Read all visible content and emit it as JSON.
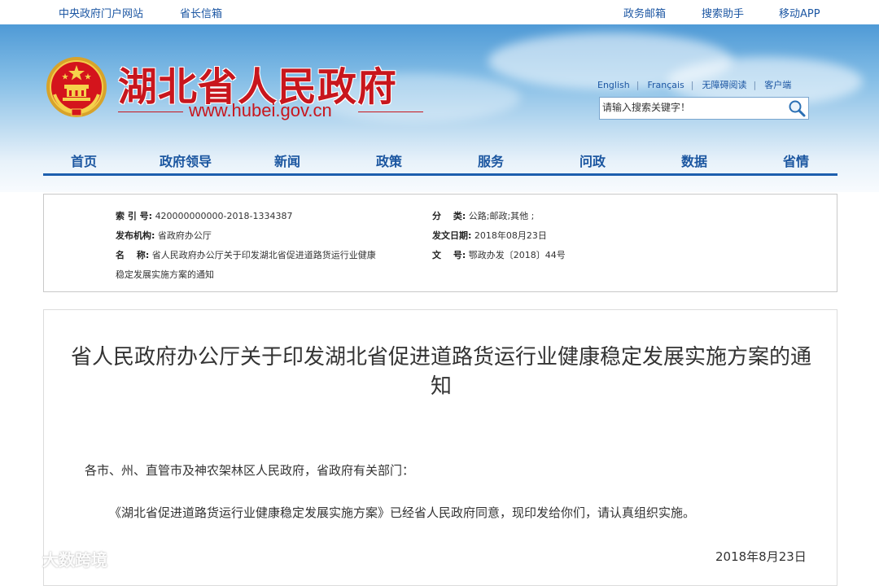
{
  "topbar": {
    "left_links": [
      "中央政府门户网站",
      "省长信箱"
    ],
    "right_links": [
      "政务邮箱",
      "搜索助手",
      "移动APP"
    ]
  },
  "header": {
    "site_title": "湖北省人民政府",
    "site_url": "www.hubei.gov.cn",
    "language_links": [
      "English",
      "Français",
      "无障碍阅读",
      "客户端"
    ],
    "search_placeholder": "请输入搜索关键字！"
  },
  "nav": {
    "items": [
      "首页",
      "政府领导",
      "新闻",
      "政策",
      "服务",
      "问政",
      "数据",
      "省情"
    ]
  },
  "meta": {
    "index_label": "索 引 号:",
    "index_value": "420000000000-2018-1334387",
    "category_label": "分　 类:",
    "category_value": "公路;邮政;其他 ;",
    "publisher_label": "发布机构:",
    "publisher_value": "省政府办公厅",
    "date_label": "发文日期:",
    "date_value": "2018年08月23日",
    "name_label": "名　 称:",
    "name_value_line1": "省人民政府办公厅关于印发湖北省促进道路货运行业健康",
    "name_value_line2": "稳定发展实施方案的通知",
    "docno_label": "文　 号:",
    "docno_value": "鄂政办发〔2018〕44号"
  },
  "article": {
    "title": "省人民政府办公厅关于印发湖北省促进道路货运行业健康稳定发展实施方案的通知",
    "paragraphs": [
      "各市、州、直管市及神农架林区人民政府，省政府有关部门：",
      "《湖北省促进道路货运行业健康稳定发展实施方案》已经省人民政府同意，现印发给你们，请认真组织实施。"
    ],
    "date": "2018年8月23日"
  },
  "watermark": {
    "text": "大数跨境"
  },
  "colors": {
    "brand_red": "#c8161d",
    "nav_blue": "#1b56a0",
    "link_blue": "#1d57a3"
  }
}
